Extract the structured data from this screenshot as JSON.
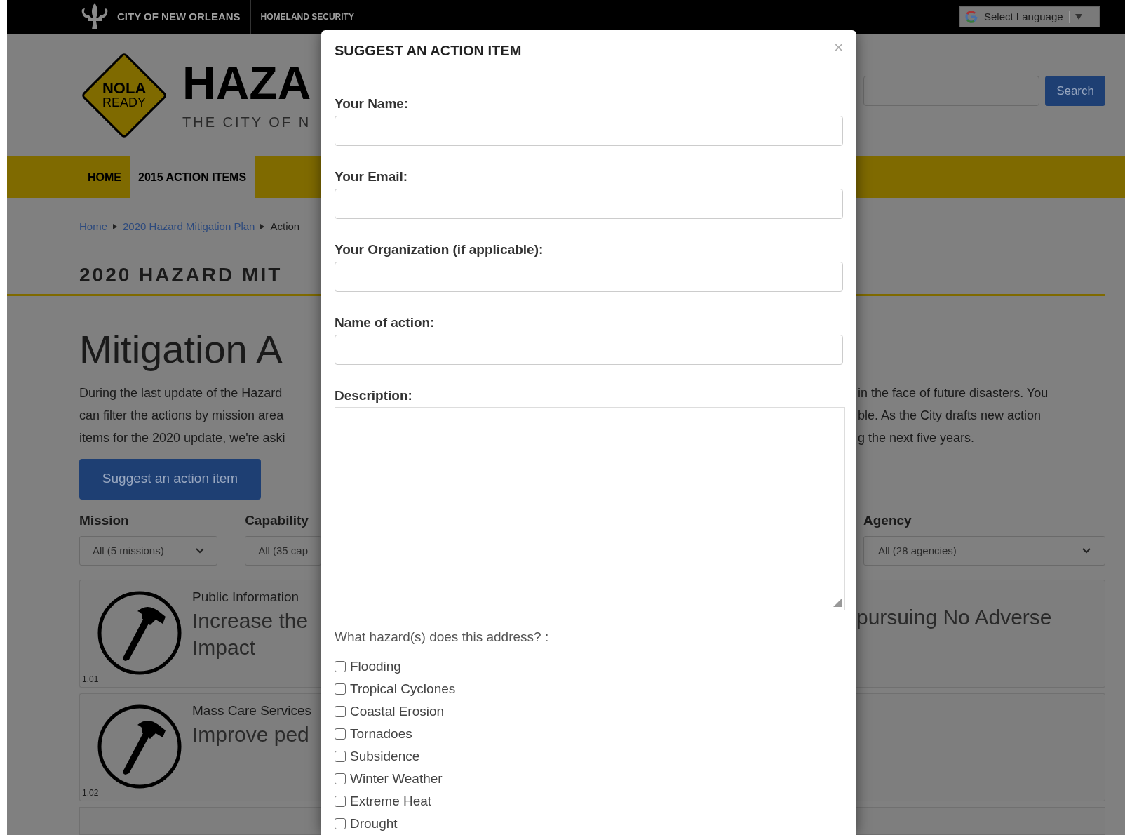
{
  "top_bar": {
    "site_name": "CITY OF NEW ORLEANS",
    "section": "HOMELAND SECURITY",
    "language_select": "Select Language"
  },
  "header": {
    "logo_lines": [
      "NOLA",
      "READY"
    ],
    "title": "HAZA",
    "subtitle": "THE CITY OF N",
    "search_button": "Search"
  },
  "nav": [
    {
      "label": "HOME",
      "selected": false
    },
    {
      "label": "2015 ACTION ITEMS",
      "selected": true
    }
  ],
  "breadcrumb": [
    {
      "label": "Home",
      "current": false
    },
    {
      "label": "2020 Hazard Mitigation Plan",
      "current": false
    },
    {
      "label": "Action",
      "current": true
    }
  ],
  "heading": "2020 HAZARD MIT",
  "page_title": "Mitigation A",
  "intro": {
    "left_lines": [
      "During the last update of the Hazard",
      "can filter the actions by mission area",
      "items for the 2020 update, we're aski"
    ],
    "right_lines": [
      "in the face of future disasters. You",
      "ble. As the City drafts new action",
      "g the next five years."
    ]
  },
  "suggest_button": "Suggest an action item",
  "filters": [
    {
      "label": "Mission",
      "value": "All (5 missions)"
    },
    {
      "label": "Capability",
      "value": "All (35 cap"
    }
  ],
  "agency_filter": {
    "label": "Agency",
    "value": "All (28 agencies)"
  },
  "actions": [
    {
      "number": "1.01",
      "mission": "Public Information",
      "title_lines": [
        "Increase the",
        "Impact"
      ],
      "title_right": "pursuing No Adverse"
    },
    {
      "number": "1.02",
      "mission": "Mass Care Services",
      "title_lines": [
        "Improve ped"
      ]
    }
  ],
  "modal": {
    "title": "SUGGEST AN ACTION ITEM",
    "close": "×",
    "fields": [
      {
        "label": "Your Name:",
        "kind": "input"
      },
      {
        "label": "Your Email:",
        "kind": "input"
      },
      {
        "label": "Your Organization (if applicable):",
        "kind": "input"
      },
      {
        "label": "Name of action:",
        "kind": "input"
      },
      {
        "label": "Description:",
        "kind": "textarea"
      }
    ],
    "hazard_question": "What hazard(s) does this address? :",
    "hazards": [
      {
        "label": "Flooding",
        "checked": false
      },
      {
        "label": "Tropical Cyclones",
        "checked": false
      },
      {
        "label": "Coastal Erosion",
        "checked": false
      },
      {
        "label": "Tornadoes",
        "checked": false
      },
      {
        "label": "Subsidence",
        "checked": false
      },
      {
        "label": "Winter Weather",
        "checked": false
      },
      {
        "label": "Extreme Heat",
        "checked": false
      },
      {
        "label": "Drought",
        "checked": false
      }
    ]
  }
}
